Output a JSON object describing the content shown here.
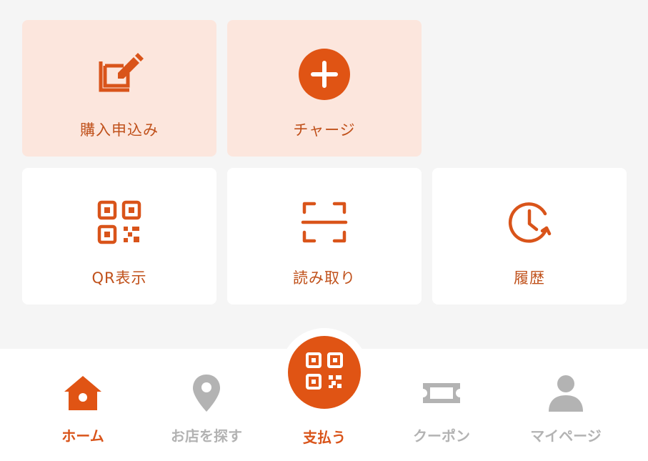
{
  "colors": {
    "accent": "#e05414",
    "accent_text": "#c0511b",
    "accent_tile_bg": "#fce6dd",
    "inactive": "#b3b3b3",
    "background": "#f5f5f5"
  },
  "tiles": [
    {
      "label": "購入申込み",
      "icon": "edit-square-icon"
    },
    {
      "label": "チャージ",
      "icon": "plus-circle-icon"
    },
    {
      "label": "QR表示",
      "icon": "qr-code-icon"
    },
    {
      "label": "読み取り",
      "icon": "scan-frame-icon"
    },
    {
      "label": "履歴",
      "icon": "history-clock-icon"
    }
  ],
  "nav": {
    "home": {
      "label": "ホーム",
      "icon": "home-icon",
      "active": true
    },
    "shop": {
      "label": "お店を探す",
      "icon": "map-pin-icon"
    },
    "pay": {
      "label": "支払う",
      "icon": "qr-code-icon"
    },
    "coupon": {
      "label": "クーポン",
      "icon": "ticket-icon"
    },
    "mypage": {
      "label": "マイページ",
      "icon": "user-icon"
    }
  }
}
